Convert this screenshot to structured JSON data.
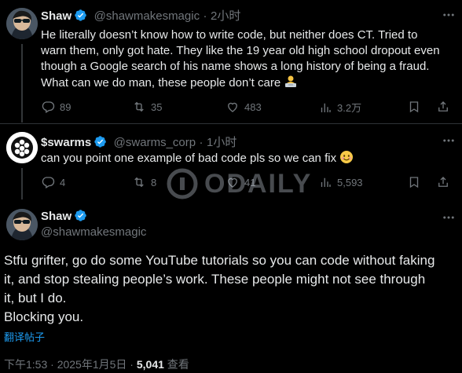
{
  "tweets": [
    {
      "name": "Shaw",
      "handle": "@shawmakesmagic",
      "dot": "·",
      "time": "2小时",
      "text_lines": [
        "He literally doesn’t know how to write code, but neither does CT. Tried to",
        "warn them, only got hate. They like the 19 year old high school dropout even",
        "though a Google search of his name shows a long history of being a fraud.",
        "What can we do man, these people don’t care"
      ],
      "emoji_icon": "person-at-laptop-emoji",
      "replies": "89",
      "retweets": "35",
      "likes": "483",
      "views": "3.2万"
    },
    {
      "name": "$swarms",
      "handle": "@swarms_corp",
      "dot": "·",
      "time": "1小时",
      "text_lines": [
        "can you point one example of bad code pls so we can fix"
      ],
      "emoji_icon": "smiling-face-emoji",
      "replies": "4",
      "retweets": "8",
      "likes": "41",
      "views": "5,593"
    }
  ],
  "main_tweet": {
    "name": "Shaw",
    "handle": "@shawmakesmagic",
    "text_lines": [
      "Stfu grifter, go do some YouTube tutorials so you can code without faking",
      "it, and stop stealing people’s work. These people might not see through",
      "it, but I do.",
      "Blocking you."
    ],
    "translate_label": "翻译帖子",
    "timestamp": "下午1:53 · 2025年1月5日 · ",
    "views_count": "5,041",
    "views_label": " 查看"
  },
  "watermark": {
    "text": "ODAILY"
  },
  "colors": {
    "background": "#000000",
    "text": "#e7e9ea",
    "muted": "#71767b",
    "accent": "#1d9bf0",
    "divider": "#2f3336"
  }
}
